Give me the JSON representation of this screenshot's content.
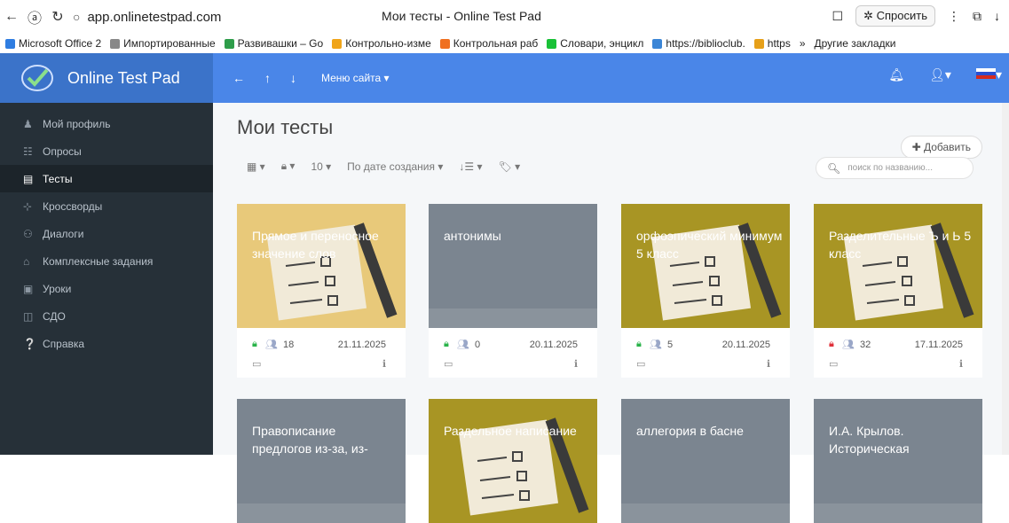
{
  "browser": {
    "url": "app.onlinetestpad.com",
    "tab_title": "Мои тесты - Online Test Pad",
    "ask_label": "Спросить",
    "bookmarks": [
      {
        "label": "Microsoft Office 2",
        "color": "#2f7de1"
      },
      {
        "label": "Импортированные",
        "color": "#888888"
      },
      {
        "label": "Развивашки – Go",
        "color": "#2e9d4a"
      },
      {
        "label": "Контрольно-изме",
        "color": "#f0a51a"
      },
      {
        "label": "Контрольная раб",
        "color": "#f07020"
      },
      {
        "label": "Словари, энцикл",
        "color": "#19c137"
      },
      {
        "label": "https://biblioclub.",
        "color": "#3b85d6"
      },
      {
        "label": "https",
        "color": "#e6a019"
      },
      {
        "label": "»",
        "color": ""
      },
      {
        "label": "Другие закладки",
        "color": ""
      }
    ]
  },
  "topnav": {
    "brand": "Online Test Pad",
    "menu_label": "Меню сайта"
  },
  "sidebar": {
    "items": [
      {
        "label": "Мой профиль",
        "icon": "user-icon"
      },
      {
        "label": "Опросы",
        "icon": "survey-icon"
      },
      {
        "label": "Тесты",
        "icon": "test-icon"
      },
      {
        "label": "Кроссворды",
        "icon": "crossword-icon"
      },
      {
        "label": "Диалоги",
        "icon": "dialog-icon"
      },
      {
        "label": "Комплексные задания",
        "icon": "complex-icon"
      },
      {
        "label": "Уроки",
        "icon": "lessons-icon"
      },
      {
        "label": "СДО",
        "icon": "lms-icon"
      },
      {
        "label": "Справка",
        "icon": "help-icon"
      }
    ]
  },
  "main": {
    "title": "Мои тесты",
    "add_label": "Добавить",
    "per_page": "10",
    "sort_label": "По дате создания",
    "search_placeholder": "поиск по названию...",
    "cards": [
      {
        "title": "Прямое и переносное значение слов",
        "count": "18",
        "date": "21.11.2025",
        "locked": false,
        "bg": "#e8c97a"
      },
      {
        "title": "антонимы",
        "count": "0",
        "date": "20.11.2025",
        "locked": false,
        "bg": "#7b8590"
      },
      {
        "title": "орфоэпический минимум 5 класс",
        "count": "5",
        "date": "20.11.2025",
        "locked": false,
        "bg": "#a89524"
      },
      {
        "title": "Разделительные Ъ и Ь 5 класс",
        "count": "32",
        "date": "17.11.2025",
        "locked": true,
        "bg": "#a89524"
      },
      {
        "title": "Правописание предлогов из-за, из-",
        "count": "",
        "date": "",
        "locked": false,
        "bg": "#7b8590"
      },
      {
        "title": "Раздельное написание",
        "count": "",
        "date": "",
        "locked": false,
        "bg": "#a89524"
      },
      {
        "title": "аллегория в басне",
        "count": "",
        "date": "",
        "locked": false,
        "bg": "#7b8590"
      },
      {
        "title": "И.А. Крылов. Историческая",
        "count": "",
        "date": "",
        "locked": false,
        "bg": "#7b8590"
      }
    ]
  }
}
